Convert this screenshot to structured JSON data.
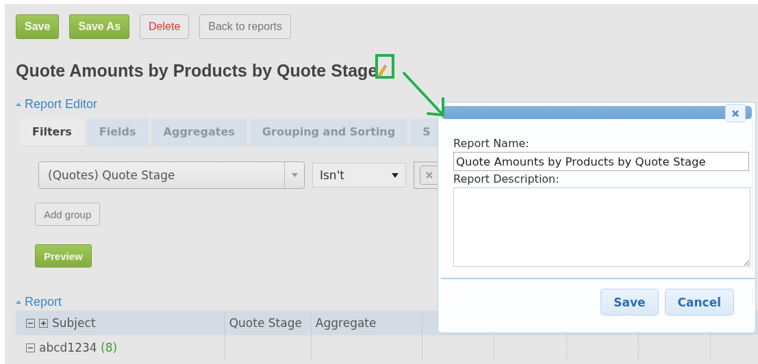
{
  "toolbar": {
    "buttons": [
      {
        "label": "Save",
        "kind": "primary"
      },
      {
        "label": "Save As",
        "kind": "primary"
      },
      {
        "label": "Delete",
        "kind": "danger"
      },
      {
        "label": "Back to reports",
        "kind": "default"
      }
    ]
  },
  "report_title": "Quote Amounts by Products by Quote Stage",
  "editor": {
    "heading": "Report Editor",
    "expanded": true,
    "tabs": [
      {
        "label": "Filters",
        "selected": true
      },
      {
        "label": "Fields",
        "selected": false
      },
      {
        "label": "Aggregates",
        "selected": false
      },
      {
        "label": "Grouping and Sorting",
        "selected": false
      },
      {
        "label": "S",
        "selected": false
      }
    ],
    "filter": {
      "field": "(Quotes) Quote Stage",
      "operator": "Isn't"
    },
    "add_group": "Add group",
    "preview": "Preview"
  },
  "report": {
    "heading": "Report",
    "expanded": true,
    "columns": [
      "Subject",
      "Quote Stage",
      "Aggregate"
    ],
    "rows": [
      {
        "subject": "abcd1234",
        "count": "(8)",
        "expanded": true
      }
    ]
  },
  "dialog": {
    "name_label": "Report Name:",
    "name_value": "Quote Amounts by Products by Quote Stage",
    "description_label": "Report Description:",
    "buttons": [
      "Save",
      "Cancel"
    ]
  }
}
